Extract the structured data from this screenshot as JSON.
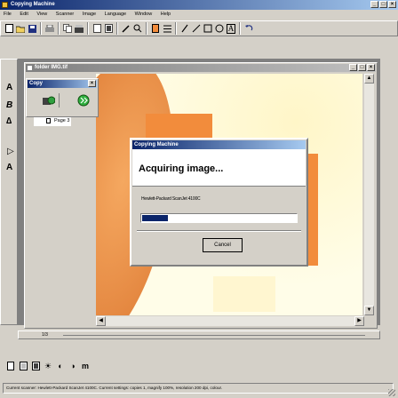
{
  "app": {
    "title": "Copying Machine",
    "menu": [
      "File",
      "Edit",
      "View",
      "Scanner",
      "Image",
      "Language",
      "Window",
      "Help"
    ]
  },
  "icons": {
    "toolbar": [
      "new-icon",
      "open-icon",
      "save-icon",
      "print-icon",
      "copy-icon",
      "scan-icon",
      "page-icon",
      "page-frame-icon",
      "pencil-icon",
      "select-icon",
      "color-swatch-icon",
      "properties-icon",
      "brush-icon",
      "line-icon",
      "rectangle-icon",
      "ellipse-icon",
      "text-icon",
      "undo-icon"
    ],
    "left_tools": [
      "tool-a-icon",
      "tool-b-icon",
      "tool-c-icon",
      "tool-d-icon",
      "tool-e-icon"
    ],
    "bottom": [
      "page-view-icon",
      "page-list-icon",
      "fit-icon",
      "brightness-icon",
      "contrast-icon",
      "mode-icon",
      "grayscale-icon"
    ]
  },
  "doc_window": {
    "title": "folder IMG.tif",
    "page_counter": "1/3"
  },
  "copy_panel": {
    "title": "Copy",
    "tree_item": "Page 3"
  },
  "dialog": {
    "title": "Copying Machine",
    "heading": "Acquiring image...",
    "scanner": "Hewlett-Packard ScanJet 4100C",
    "progress": 0.17,
    "cancel_label": "Cancel"
  },
  "status": {
    "text": "Current scanner: Hewlett-Packard ScanJet 4100C. Current settings: copies 1, magnify 100%, resolution 200 dpi, colour."
  },
  "colors": {
    "accent": "#0a246a",
    "progress": "#0a246a",
    "orange": "#f28c3c",
    "page_bg": "#fffde8"
  }
}
